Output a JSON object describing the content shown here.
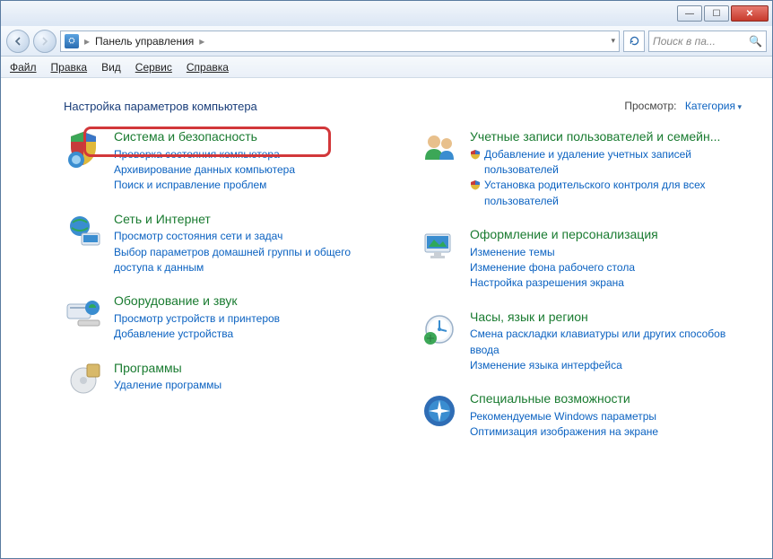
{
  "address": {
    "root": "Панель управления"
  },
  "search": {
    "placeholder": "Поиск в па..."
  },
  "menu": {
    "file": "Файл",
    "edit": "Правка",
    "view": "Вид",
    "tools": "Сервис",
    "help": "Справка"
  },
  "heading": "Настройка параметров компьютера",
  "viewLabel": "Просмотр:",
  "viewValue": "Категория",
  "left": {
    "system": {
      "title": "Система и безопасность",
      "l1": "Проверка состояния компьютера",
      "l2": "Архивирование данных компьютера",
      "l3": "Поиск и исправление проблем"
    },
    "network": {
      "title": "Сеть и Интернет",
      "l1": "Просмотр состояния сети и задач",
      "l2": "Выбор параметров домашней группы и общего доступа к данным"
    },
    "hardware": {
      "title": "Оборудование и звук",
      "l1": "Просмотр устройств и принтеров",
      "l2": "Добавление устройства"
    },
    "programs": {
      "title": "Программы",
      "l1": "Удаление программы"
    }
  },
  "right": {
    "users": {
      "title": "Учетные записи пользователей и семейн...",
      "l1": "Добавление и удаление учетных записей пользователей",
      "l2": "Установка родительского контроля для всех пользователей"
    },
    "appearance": {
      "title": "Оформление и персонализация",
      "l1": "Изменение темы",
      "l2": "Изменение фона рабочего стола",
      "l3": "Настройка разрешения экрана"
    },
    "clock": {
      "title": "Часы, язык и регион",
      "l1": "Смена раскладки клавиатуры или других способов ввода",
      "l2": "Изменение языка интерфейса"
    },
    "ease": {
      "title": "Специальные возможности",
      "l1": "Рекомендуемые Windows параметры",
      "l2": "Оптимизация изображения на экране"
    }
  }
}
